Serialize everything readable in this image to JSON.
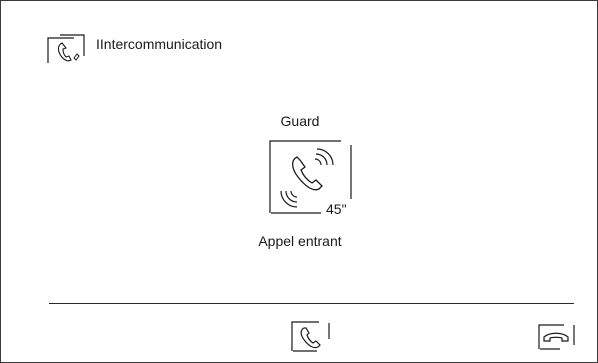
{
  "header": {
    "title": "IIntercommunication",
    "icon": "intercom-handset-icon"
  },
  "call": {
    "caller_name": "Guard",
    "icon": "incoming-call-icon",
    "timer": "45\"",
    "status": "Appel entrant"
  },
  "actions": {
    "answer_icon": "answer-call-icon",
    "hangup_icon": "hang-up-icon"
  }
}
